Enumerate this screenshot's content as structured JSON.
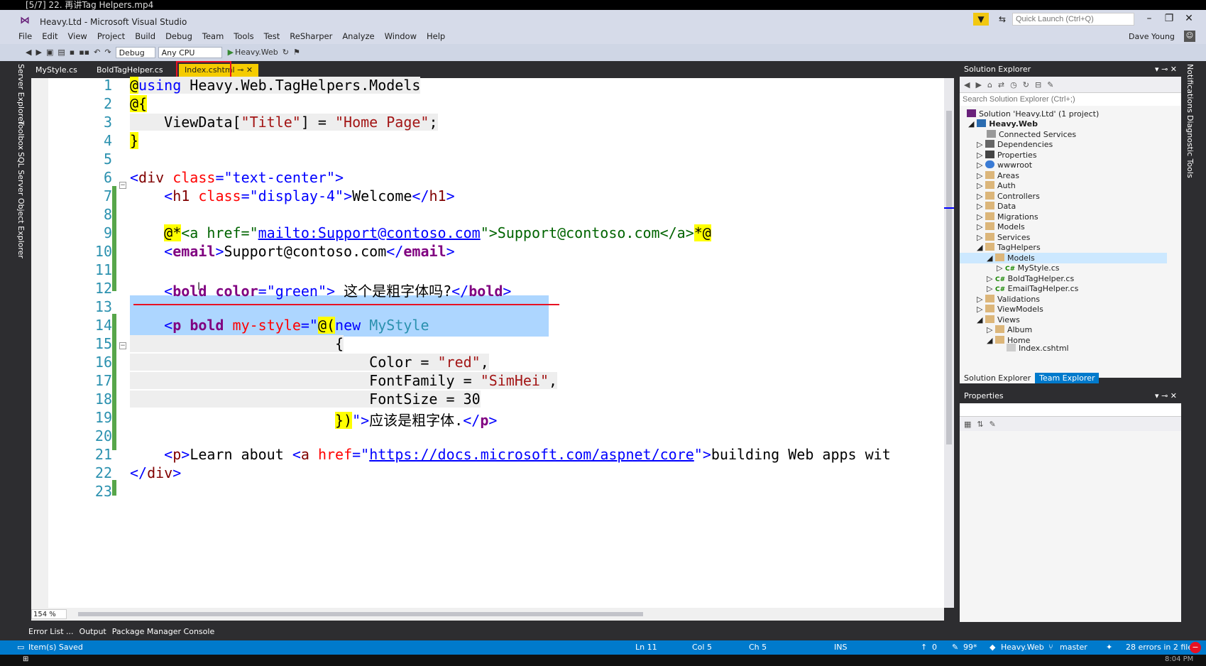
{
  "player": {
    "title": "[5/7] 22. 再讲Tag Helpers.mp4"
  },
  "window": {
    "title": "Heavy.Ltd - Microsoft Visual Studio",
    "quick_launch_placeholder": "Quick Launch (Ctrl+Q)",
    "user": "Dave Young"
  },
  "menu": [
    "File",
    "Edit",
    "View",
    "Project",
    "Build",
    "Debug",
    "Team",
    "Tools",
    "Test",
    "ReSharper",
    "Analyze",
    "Window",
    "Help"
  ],
  "toolbar": {
    "config": "Debug",
    "platform": "Any CPU",
    "start_project": "Heavy.Web"
  },
  "left_strip": [
    "Server Explorer",
    "Toolbox",
    "SQL Server Object Explorer"
  ],
  "tabs": [
    {
      "label": "MyStyle.cs"
    },
    {
      "label": "BoldTagHelper.cs"
    },
    {
      "label": "Index.cshtml",
      "active": true
    }
  ],
  "editor": {
    "line_numbers": [
      "1",
      "2",
      "3",
      "4",
      "5",
      "6",
      "7",
      "8",
      "9",
      "10",
      "11",
      "12",
      "13",
      "14",
      "15",
      "16",
      "17",
      "18",
      "19",
      "20",
      "21",
      "22",
      "23"
    ],
    "zoom": "154 %"
  },
  "solution_explorer": {
    "title": "Solution Explorer",
    "search_placeholder": "Search Solution Explorer (Ctrl+;)",
    "items": [
      {
        "label": "Solution 'Heavy.Ltd' (1 project)"
      },
      {
        "label": "Heavy.Web"
      },
      {
        "label": "Connected Services"
      },
      {
        "label": "Dependencies"
      },
      {
        "label": "Properties"
      },
      {
        "label": "wwwroot"
      },
      {
        "label": "Areas"
      },
      {
        "label": "Auth"
      },
      {
        "label": "Controllers"
      },
      {
        "label": "Data"
      },
      {
        "label": "Migrations"
      },
      {
        "label": "Models"
      },
      {
        "label": "Services"
      },
      {
        "label": "TagHelpers"
      },
      {
        "label": "Models"
      },
      {
        "label": "MyStyle.cs"
      },
      {
        "label": "BoldTagHelper.cs"
      },
      {
        "label": "EmailTagHelper.cs"
      },
      {
        "label": "Validations"
      },
      {
        "label": "ViewModels"
      },
      {
        "label": "Views"
      },
      {
        "label": "Album"
      },
      {
        "label": "Home"
      },
      {
        "label": "Index.cshtml"
      }
    ],
    "tab_solution": "Solution Explorer",
    "tab_team": "Team Explorer"
  },
  "right_strip": [
    "Notifications",
    "Diagnostic Tools"
  ],
  "properties": {
    "title": "Properties"
  },
  "bottom_tabs": [
    "Error List ...",
    "Output",
    "Package Manager Console"
  ],
  "status": {
    "message": "Item(s) Saved",
    "ln": "Ln 11",
    "col": "Col 5",
    "ch": "Ch 5",
    "ins": "INS",
    "up": "0",
    "pencil": "99*",
    "project": "Heavy.Web",
    "branch": "master",
    "errors": "28 errors in 2 files",
    "clock": "8:04 PM"
  },
  "colors": {
    "accent": "#007acc",
    "tab_active": "#f5cc00",
    "highlight": "#e81123"
  }
}
